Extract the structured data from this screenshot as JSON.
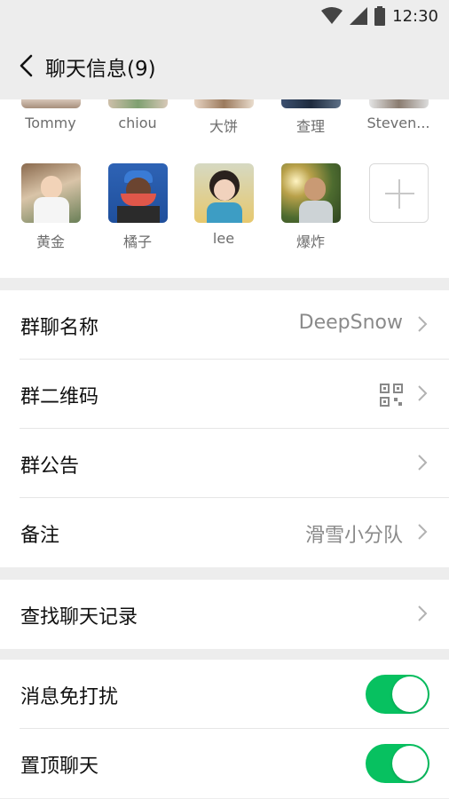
{
  "status_bar": {
    "time": "12:30"
  },
  "nav": {
    "title": "聊天信息(9)"
  },
  "members_row1": [
    "Tommy",
    "chiou",
    "大饼",
    "查理",
    "Steven..."
  ],
  "members_row2": [
    "黄金",
    "橘子",
    "lee",
    "爆炸"
  ],
  "settings": {
    "group_name_label": "群聊名称",
    "group_name_value": "DeepSnow",
    "qr_label": "群二维码",
    "announcement_label": "群公告",
    "remark_label": "备注",
    "remark_value": "滑雪小分队",
    "search_label": "查找聊天记录",
    "mute_label": "消息免打扰",
    "pin_label": "置顶聊天"
  },
  "switches": {
    "mute_on": true,
    "pin_on": true
  },
  "colors": {
    "accent": "#07c160",
    "background": "#ededed"
  }
}
